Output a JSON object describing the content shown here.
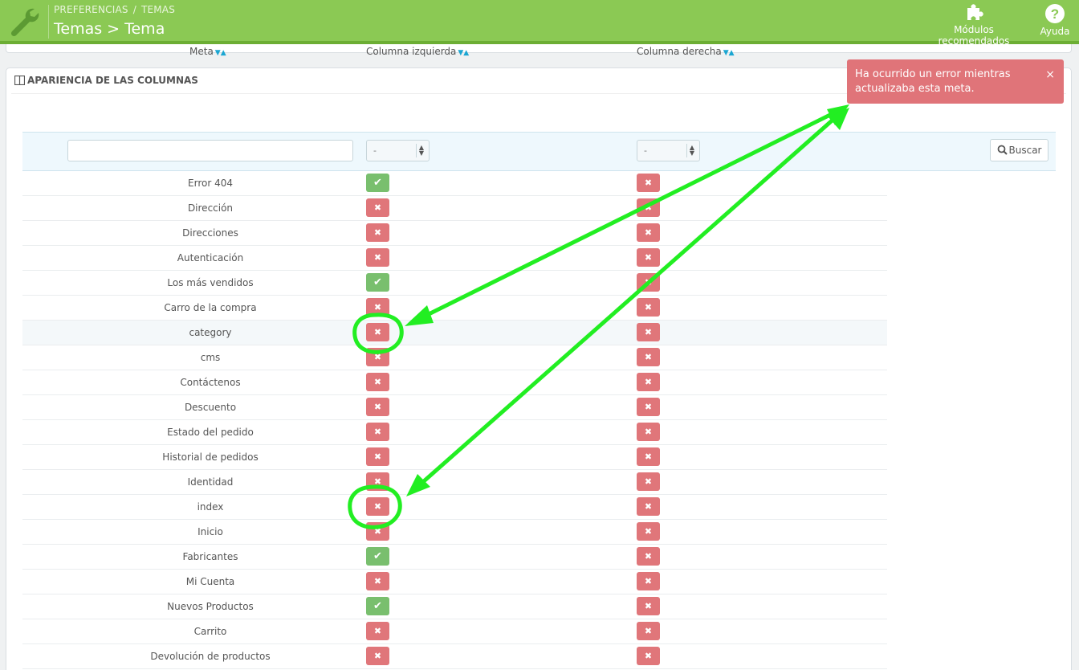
{
  "header": {
    "breadcrumb": [
      "PREFERENCIAS",
      "TEMAS"
    ],
    "breadcrumb_sep": "/",
    "title": "Temas > Tema",
    "modules_label": "Módulos recomendados",
    "help_label": "Ayuda",
    "colors": {
      "bar": "#8bc954",
      "bar_border": "#6cae34"
    }
  },
  "panel": {
    "heading": "APARIENCIA DE LAS COLUMNAS",
    "columns": [
      "Meta",
      "Columna izquierda",
      "Columna derecha"
    ],
    "filter": {
      "meta_value": "",
      "left_select": "-",
      "right_select": "-",
      "search_button": "Buscar"
    }
  },
  "rows": [
    {
      "name": "Error 404",
      "left": true,
      "right": false
    },
    {
      "name": "Dirección",
      "left": false,
      "right": false
    },
    {
      "name": "Direcciones",
      "left": false,
      "right": false
    },
    {
      "name": "Autenticación",
      "left": false,
      "right": false
    },
    {
      "name": "Los más vendidos",
      "left": true,
      "right": false
    },
    {
      "name": "Carro de la compra",
      "left": false,
      "right": false
    },
    {
      "name": "category",
      "left": false,
      "right": false,
      "highlighted": true
    },
    {
      "name": "cms",
      "left": false,
      "right": false
    },
    {
      "name": "Contáctenos",
      "left": false,
      "right": false
    },
    {
      "name": "Descuento",
      "left": false,
      "right": false
    },
    {
      "name": "Estado del pedido",
      "left": false,
      "right": false
    },
    {
      "name": "Historial de pedidos",
      "left": false,
      "right": false
    },
    {
      "name": "Identidad",
      "left": false,
      "right": false
    },
    {
      "name": "index",
      "left": false,
      "right": false
    },
    {
      "name": "Inicio",
      "left": false,
      "right": false
    },
    {
      "name": "Fabricantes",
      "left": true,
      "right": false
    },
    {
      "name": "Mi Cuenta",
      "left": false,
      "right": false
    },
    {
      "name": "Nuevos Productos",
      "left": true,
      "right": false
    },
    {
      "name": "Carrito",
      "left": false,
      "right": false
    },
    {
      "name": "Devolución de productos",
      "left": false,
      "right": false
    }
  ],
  "alert": {
    "message": "Ha ocurrido un error mientras actualizaba esta meta.",
    "close": "×",
    "color": "#e07479"
  },
  "icons": {
    "on": "check-icon",
    "off": "x-icon",
    "annotation_color": "#22ee22"
  }
}
